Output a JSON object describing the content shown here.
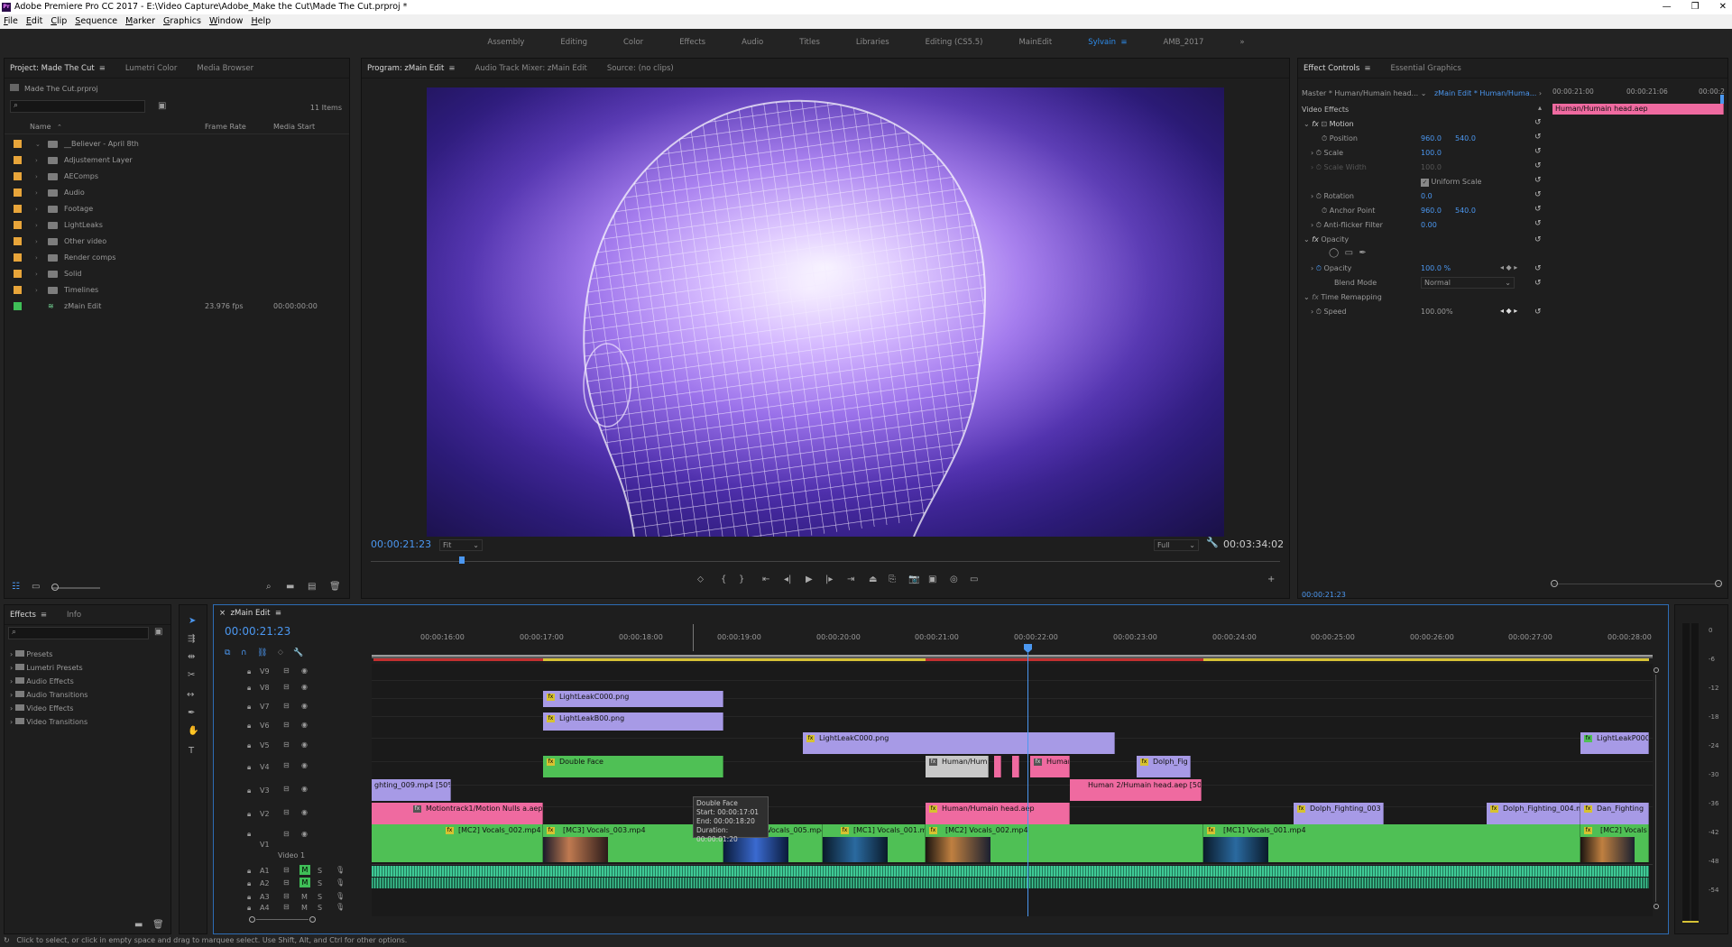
{
  "title_bar": {
    "title": "Adobe Premiere Pro CC 2017 - E:\\Video Capture\\Adobe_Make the Cut\\Made The Cut.prproj *",
    "app_badge": "Pr"
  },
  "menu": [
    "File",
    "Edit",
    "Clip",
    "Sequence",
    "Marker",
    "Graphics",
    "Window",
    "Help"
  ],
  "workspaces": [
    "Assembly",
    "Editing",
    "Color",
    "Effects",
    "Audio",
    "Titles",
    "Libraries",
    "Editing (CS5.5)",
    "MainEdit",
    "Sylvain",
    "AMB_2017"
  ],
  "active_workspace": "Sylvain",
  "project_panel": {
    "tabs": [
      "Project: Made The Cut",
      "Lumetri Color",
      "Media Browser"
    ],
    "project_file": "Made The Cut.prproj",
    "items_count": "11 Items",
    "columns": [
      "Name",
      "Frame Rate",
      "Media Start"
    ],
    "items": [
      {
        "name": "__Believer - April 8th",
        "color": "#e8a53a",
        "fps": "",
        "start": ""
      },
      {
        "name": "Adjustement Layer",
        "color": "#e8a53a",
        "fps": "",
        "start": ""
      },
      {
        "name": "AEComps",
        "color": "#e8a53a",
        "fps": "",
        "start": ""
      },
      {
        "name": "Audio",
        "color": "#e8a53a",
        "fps": "",
        "start": ""
      },
      {
        "name": "Footage",
        "color": "#e8a53a",
        "fps": "",
        "start": ""
      },
      {
        "name": "LightLeaks",
        "color": "#e8a53a",
        "fps": "",
        "start": ""
      },
      {
        "name": "Other video",
        "color": "#e8a53a",
        "fps": "",
        "start": ""
      },
      {
        "name": "Render comps",
        "color": "#e8a53a",
        "fps": "",
        "start": ""
      },
      {
        "name": "Solid",
        "color": "#e8a53a",
        "fps": "",
        "start": ""
      },
      {
        "name": "Timelines",
        "color": "#e8a53a",
        "fps": "",
        "start": ""
      },
      {
        "name": "zMain Edit",
        "color": "#3fbf57",
        "fps": "23.976 fps",
        "start": "00:00:00:00"
      }
    ]
  },
  "program_monitor": {
    "tabs": [
      "Program: zMain Edit",
      "Audio Track Mixer: zMain Edit",
      "Source: (no clips)"
    ],
    "timecode": "00:00:21:23",
    "fit": "Fit",
    "quality": "Full",
    "duration": "00:03:34:02"
  },
  "effect_controls": {
    "tabs": [
      "Effect Controls",
      "Essential Graphics"
    ],
    "master": "Master * Human/Humain head...",
    "sequence": "zMain Edit * Human/Huma...",
    "section": "Video Effects",
    "mini_times": [
      "00:00:21:00",
      "00:00:21:06",
      "00:00:2"
    ],
    "mini_clip": "Human/Humain head.aep",
    "motion": "Motion",
    "position_label": "Position",
    "position_x": "960.0",
    "position_y": "540.0",
    "scale_label": "Scale",
    "scale": "100.0",
    "scale_width_label": "Scale Width",
    "scale_width": "100.0",
    "uniform_scale": "Uniform Scale",
    "rotation_label": "Rotation",
    "rotation": "0.0",
    "anchor_label": "Anchor Point",
    "anchor_x": "960.0",
    "anchor_y": "540.0",
    "antiflicker_label": "Anti-flicker Filter",
    "antiflicker": "0.00",
    "opacity_section": "Opacity",
    "opacity_label": "Opacity",
    "opacity": "100.0 %",
    "blend_label": "Blend Mode",
    "blend": "Normal",
    "time_remap": "Time Remapping",
    "speed_label": "Speed",
    "speed": "100.00%",
    "timecode": "00:00:21:23"
  },
  "effects_panel": {
    "tabs": [
      "Effects",
      "Info"
    ],
    "items": [
      "Presets",
      "Lumetri Presets",
      "Audio Effects",
      "Audio Transitions",
      "Video Effects",
      "Video Transitions"
    ]
  },
  "timeline": {
    "tab": "zMain Edit",
    "timecode": "00:00:21:23",
    "ruler": [
      "00:00:16:00",
      "00:00:17:00",
      "00:00:18:00",
      "00:00:19:00",
      "00:00:20:00",
      "00:00:21:00",
      "00:00:22:00",
      "00:00:23:00",
      "00:00:24:00",
      "00:00:25:00",
      "00:00:26:00",
      "00:00:27:00",
      "00:00:28:00"
    ],
    "video_tracks": [
      "V9",
      "V8",
      "V7",
      "V6",
      "V5",
      "V4",
      "V3",
      "V2",
      "V1"
    ],
    "v1_name": "Video 1",
    "audio_tracks": [
      "A1",
      "A2",
      "A3",
      "A4"
    ],
    "clips": {
      "v7a": "LightLeakC000.png",
      "v6a": "LightLeakB00.png",
      "v5a": "LightLeakC000.png",
      "v5b": "LightLeakP000",
      "v4a": "Double Face",
      "v4b": "Human/Hum",
      "v4c": "Human",
      "v4d": "Dolph_Fig",
      "v3a": "ghting_009.mp4 [50%]",
      "v3b": "Human 2/Humain head.aep [50%]",
      "v2a": "Motiontrack1/Motion Nulls a.aep",
      "v2b": "Human/Humain head.aep",
      "v2c": "Dolph_Fighting_003",
      "v2d": "Dolph_Fighting_004.m",
      "v2e": "Dan_Fighting",
      "v1a": "[MC2] Vocals_002.mp4",
      "v1b": "[MC3] Vocals_003.mp4",
      "v1c": "Vocals_005.mp4",
      "v1d": "[MC1] Vocals_001.mp4",
      "v1e": "[MC2] Vocals_002.mp4",
      "v1f": "[MC1] Vocals_001.mp4",
      "v1g": "[MC2] Vocals"
    },
    "tooltip": [
      "Double Face",
      "Start: 00:00:17:01",
      "End: 00:00:18:20",
      "Duration: 00:00:01:20"
    ]
  },
  "meter_labels": [
    "0",
    "-6",
    "-12",
    "-18",
    "-24",
    "-30",
    "-36",
    "-42",
    "-48",
    "-54"
  ],
  "status": "Click to select, or click in empty space and drag to marquee select. Use Shift, Alt, and Ctrl for other options."
}
